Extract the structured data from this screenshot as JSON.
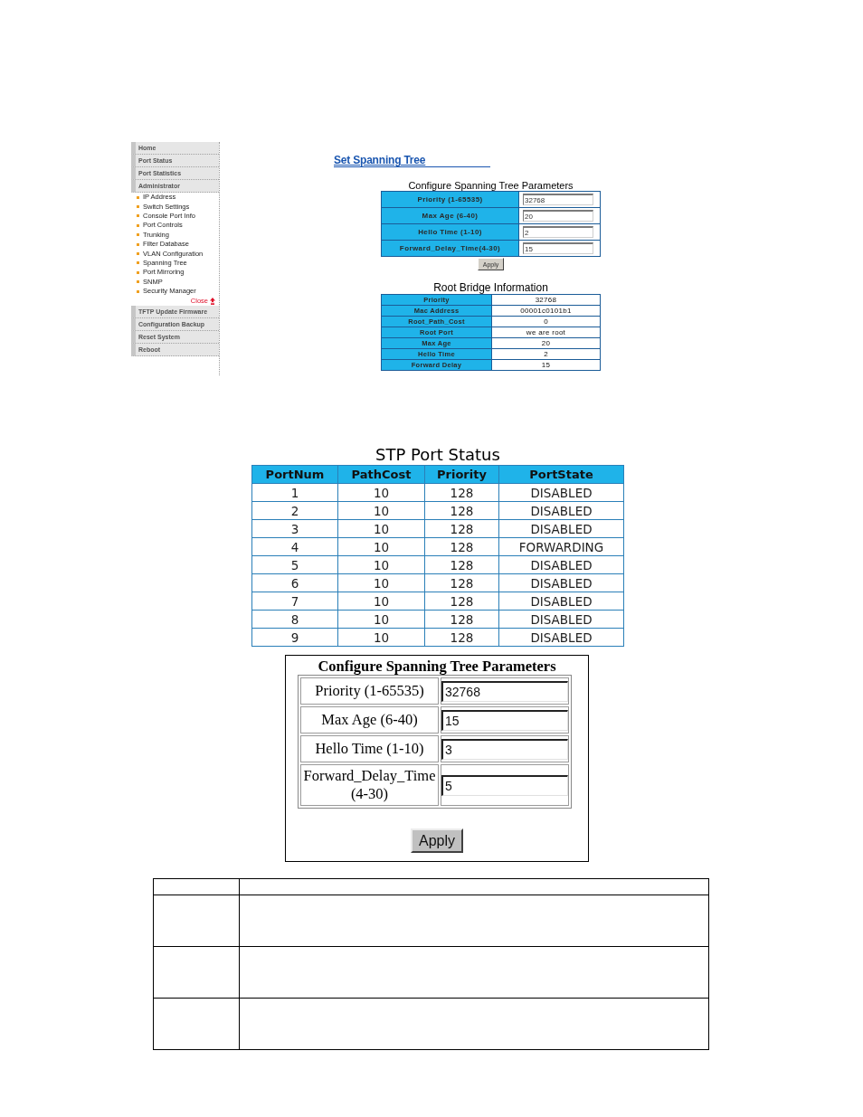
{
  "web_ui": {
    "sidebar": {
      "items": [
        {
          "kind": "main",
          "label": "Home"
        },
        {
          "kind": "main",
          "label": "Port Status"
        },
        {
          "kind": "main",
          "label": "Port Statistics"
        },
        {
          "kind": "main",
          "label": "Administrator"
        },
        {
          "kind": "sub",
          "label": "IP Address"
        },
        {
          "kind": "sub",
          "label": "Switch Settings"
        },
        {
          "kind": "sub",
          "label": "Console Port Info"
        },
        {
          "kind": "sub",
          "label": "Port Controls"
        },
        {
          "kind": "sub",
          "label": "Trunking"
        },
        {
          "kind": "sub",
          "label": "Filter Database"
        },
        {
          "kind": "sub",
          "label": "VLAN Configuration"
        },
        {
          "kind": "sub",
          "label": "Spanning Tree"
        },
        {
          "kind": "sub",
          "label": "Port Mirroring"
        },
        {
          "kind": "sub",
          "label": "SNMP"
        },
        {
          "kind": "sub",
          "label": "Security Manager"
        },
        {
          "kind": "close",
          "label": "Close"
        },
        {
          "kind": "main",
          "label": "TFTP Update Firmware"
        },
        {
          "kind": "main",
          "label": "Configuration Backup"
        },
        {
          "kind": "main",
          "label": "Reset System"
        },
        {
          "kind": "main",
          "label": "Reboot"
        }
      ]
    },
    "page_title": "Set Spanning Tree",
    "parameters_form": {
      "caption": "Configure Spanning Tree Parameters",
      "fields": [
        {
          "label": "Priority (1-65535)",
          "value": "32768"
        },
        {
          "label": "Max Age (6-40)",
          "value": "20"
        },
        {
          "label": "Hello Time (1-10)",
          "value": "2"
        },
        {
          "label": "Forward_Delay_Time(4-30)",
          "value": "15"
        }
      ],
      "apply_button": "Apply"
    },
    "root_bridge": {
      "caption": "Root Bridge Information",
      "rows": [
        {
          "label": "Priority",
          "value": "32768"
        },
        {
          "label": "Mac Address",
          "value": "00001c0101b1"
        },
        {
          "label": "Root_Path_Cost",
          "value": "0"
        },
        {
          "label": "Root Port",
          "value": "we are root"
        },
        {
          "label": "Max Age",
          "value": "20"
        },
        {
          "label": "Hello Time",
          "value": "2"
        },
        {
          "label": "Forward Delay",
          "value": "15"
        }
      ]
    }
  },
  "stp_port_status": {
    "title": "STP Port Status",
    "columns": [
      "PortNum",
      "PathCost",
      "Priority",
      "PortState"
    ],
    "rows": [
      [
        "1",
        "10",
        "128",
        "DISABLED"
      ],
      [
        "2",
        "10",
        "128",
        "DISABLED"
      ],
      [
        "3",
        "10",
        "128",
        "DISABLED"
      ],
      [
        "4",
        "10",
        "128",
        "FORWARDING"
      ],
      [
        "5",
        "10",
        "128",
        "DISABLED"
      ],
      [
        "6",
        "10",
        "128",
        "DISABLED"
      ],
      [
        "7",
        "10",
        "128",
        "DISABLED"
      ],
      [
        "8",
        "10",
        "128",
        "DISABLED"
      ],
      [
        "9",
        "10",
        "128",
        "DISABLED"
      ]
    ]
  },
  "parameters_dialog": {
    "title": "Configure Spanning Tree Parameters",
    "fields": [
      {
        "label": "Priority (1-65535)",
        "value": "32768"
      },
      {
        "label": "Max Age (6-40)",
        "value": "15"
      },
      {
        "label": "Hello Time (1-10)",
        "value": "3"
      },
      {
        "label": "Forward_Delay_Time (4-30)",
        "value": "5"
      }
    ],
    "apply_button": "Apply"
  },
  "blank_table": {
    "rows": [
      {
        "kind": "header"
      },
      {
        "kind": "body"
      },
      {
        "kind": "body"
      },
      {
        "kind": "body"
      }
    ]
  }
}
